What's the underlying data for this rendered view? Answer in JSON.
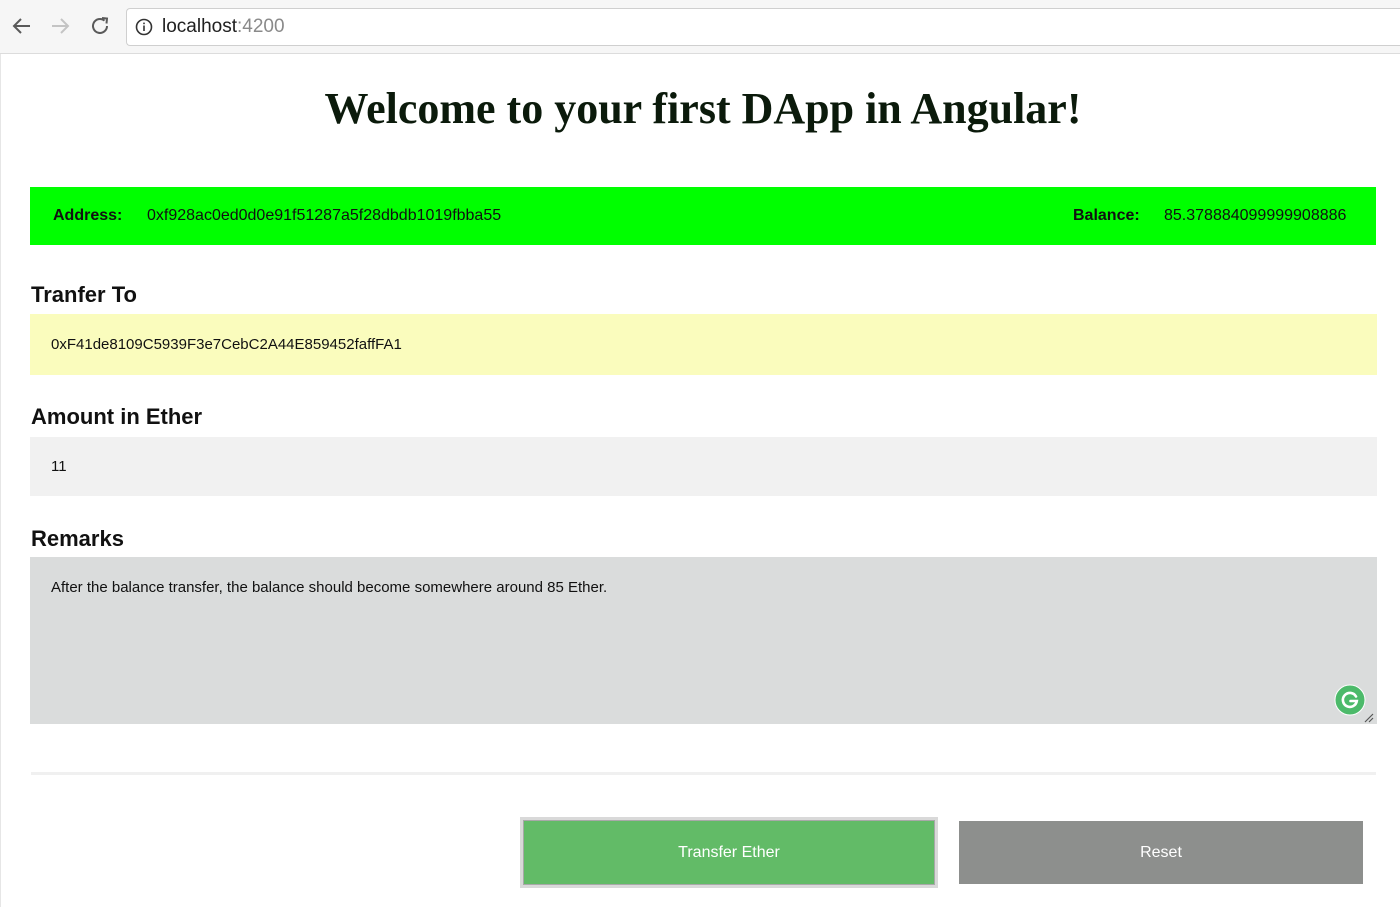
{
  "browser": {
    "url_host": "localhost",
    "url_port": ":4200",
    "icons": [
      "back-arrow-icon",
      "forward-arrow-icon",
      "reload-icon",
      "info-icon"
    ]
  },
  "page": {
    "title": "Welcome to your first DApp in Angular!"
  },
  "account": {
    "address_label": "Address:",
    "address": "0xf928ac0ed0d0e91f51287a5f28dbdb1019fbba55",
    "balance_label": "Balance:",
    "balance": "85.378884099999908886",
    "bar_color": "#00ff00"
  },
  "form": {
    "transfer_to_label": "Tranfer To",
    "transfer_to_value": "0xF41de8109C5939F3e7CebC2A44E859452faffFA1",
    "amount_label": "Amount in Ether",
    "amount_value": "11",
    "remarks_label": "Remarks",
    "remarks_value": "After the balance transfer, the balance should become somewhere around 85 Ether."
  },
  "buttons": {
    "transfer_label": "Transfer Ether",
    "reset_label": "Reset",
    "transfer_color": "#62bb67",
    "reset_color": "#8d8f8d"
  }
}
